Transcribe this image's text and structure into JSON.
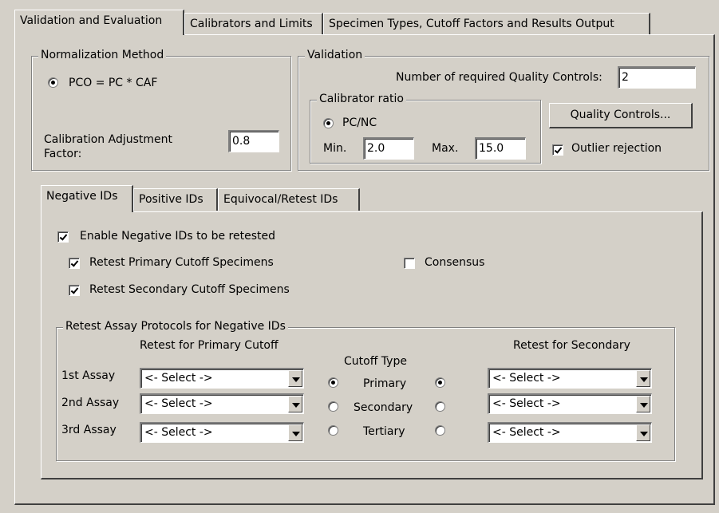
{
  "top_tabs": [
    {
      "label": "Validation and Evaluation",
      "active": true
    },
    {
      "label": "Calibrators and Limits",
      "active": false
    },
    {
      "label": "Specimen Types, Cutoff Factors and Results Output",
      "active": false
    }
  ],
  "normalization": {
    "title": "Normalization Method",
    "radio_label": "PCO = PC * CAF",
    "caf_label_line1": "Calibration Adjustment",
    "caf_label_line2": "Factor:",
    "caf_value": "0.8"
  },
  "validation": {
    "title": "Validation",
    "qc_label": "Number of required Quality Controls:",
    "qc_value": "2",
    "calibrator_ratio": {
      "title": "Calibrator ratio",
      "radio_label": "PC/NC",
      "min_label": "Min.",
      "min_value": "2.0",
      "max_label": "Max.",
      "max_value": "15.0"
    },
    "qc_button": "Quality Controls...",
    "outlier_label": "Outlier rejection",
    "outlier_checked": true
  },
  "inner_tabs": [
    {
      "label": "Negative IDs",
      "active": true
    },
    {
      "label": "Positive IDs",
      "active": false
    },
    {
      "label": "Equivocal/Retest IDs",
      "active": false
    }
  ],
  "negative": {
    "enable_label": "Enable Negative IDs to be retested",
    "retest_primary_label": "Retest Primary Cutoff Specimens",
    "retest_secondary_label": "Retest Secondary Cutoff Specimens",
    "consensus_label": "Consensus"
  },
  "protocols": {
    "title": "Retest Assay Protocols for Negative IDs",
    "primary_header": "Retest for Primary Cutoff",
    "cutoff_header": "Cutoff Type",
    "secondary_header": "Retest for Secondary",
    "rows": [
      {
        "label": "1st Assay",
        "cutoff": "Primary",
        "primary_select": "<- Select ->",
        "secondary_select": "<- Select ->"
      },
      {
        "label": "2nd Assay",
        "cutoff": "Secondary",
        "primary_select": "<- Select ->",
        "secondary_select": "<- Select ->"
      },
      {
        "label": "3rd Assay",
        "cutoff": "Tertiary",
        "primary_select": "<- Select ->",
        "secondary_select": "<- Select ->"
      }
    ]
  }
}
